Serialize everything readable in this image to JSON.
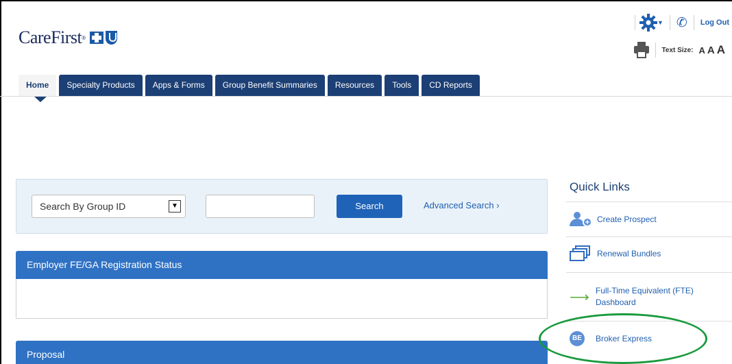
{
  "brand": {
    "logo_text": "CareFirst",
    "logo_mark": "®"
  },
  "utility": {
    "gear_icon": "gear-icon",
    "phone_icon": "phone-icon",
    "logout_label": "Log Out",
    "text_size_label": "Text Size:",
    "text_size_options": [
      "A",
      "A",
      "A"
    ]
  },
  "nav": {
    "tabs": [
      {
        "label": "Home"
      },
      {
        "label": "Specialty Products"
      },
      {
        "label": "Apps & Forms"
      },
      {
        "label": "Group Benefit Summaries"
      },
      {
        "label": "Resources"
      },
      {
        "label": "Tools"
      },
      {
        "label": "CD Reports"
      }
    ],
    "active_tab": "Home"
  },
  "search": {
    "select_value": "Search By Group ID",
    "input_value": "",
    "button_label": "Search",
    "advanced_label": "Advanced Search ›"
  },
  "cards": {
    "registration_title": "Employer FE/GA Registration Status",
    "proposal_title": "Proposal"
  },
  "quick_links": {
    "title": "Quick Links",
    "items": [
      {
        "label": "Create Prospect",
        "icon": "add-person-icon"
      },
      {
        "label": "Renewal Bundles",
        "icon": "bundles-icon"
      },
      {
        "label": "Full-Time Equivalent (FTE) Dashboard",
        "icon": "arrow-right-icon"
      },
      {
        "label": "Broker Express",
        "icon": "be-badge-icon",
        "badge_text": "BE"
      }
    ]
  },
  "colors": {
    "nav_tab": "#1c3f75",
    "primary_button": "#1f63b8",
    "card_header": "#2f72c4",
    "link": "#1f5fb0",
    "highlight": "#1a9a3e"
  }
}
